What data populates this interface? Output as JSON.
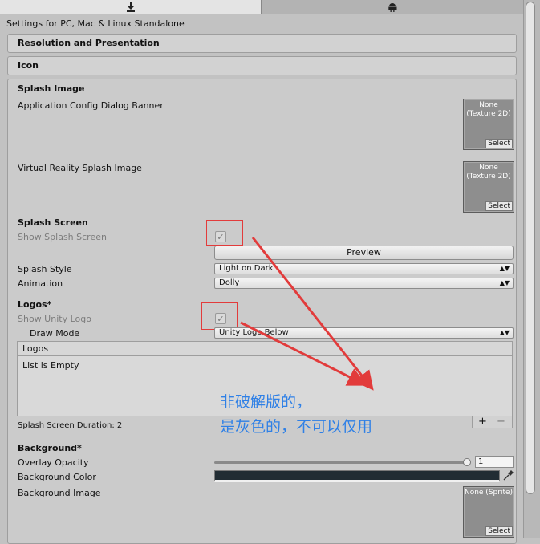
{
  "tabs": {
    "pc_icon": "download-icon",
    "android_icon": "android-icon"
  },
  "platform_title": "Settings for PC, Mac & Linux Standalone",
  "foldouts": {
    "resolution": "Resolution and Presentation",
    "icon": "Icon",
    "splash_image": "Splash Image"
  },
  "splash_image": {
    "config_banner_label": "Application Config Dialog Banner",
    "config_banner_value": "None (Texture 2D)",
    "vr_splash_label": "Virtual Reality Splash Image",
    "vr_splash_value": "None (Texture 2D)",
    "select_label": "Select"
  },
  "splash_screen": {
    "header": "Splash Screen",
    "show_label": "Show Splash Screen",
    "show_checked": true,
    "preview_label": "Preview",
    "style_label": "Splash Style",
    "style_value": "Light on Dark",
    "animation_label": "Animation",
    "animation_value": "Dolly"
  },
  "logos": {
    "header": "Logos*",
    "show_unity_label": "Show Unity Logo",
    "show_unity_checked": true,
    "draw_mode_label": "Draw Mode",
    "draw_mode_value": "Unity Logo Below",
    "list_title": "Logos",
    "list_empty": "List is Empty",
    "add": "+",
    "remove": "−",
    "duration": "Splash Screen Duration: 2"
  },
  "background": {
    "header": "Background*",
    "overlay_label": "Overlay Opacity",
    "overlay_value": "1",
    "overlay_fraction": 1.0,
    "color_label": "Background Color",
    "color_hex": "#212c33",
    "image_label": "Background Image",
    "image_value": "None (Sprite)",
    "select_label": "Select"
  },
  "annotation": {
    "line1": "非破解版的，",
    "line2": "是灰色的，不可以仅用",
    "color": "#e23b3b"
  }
}
